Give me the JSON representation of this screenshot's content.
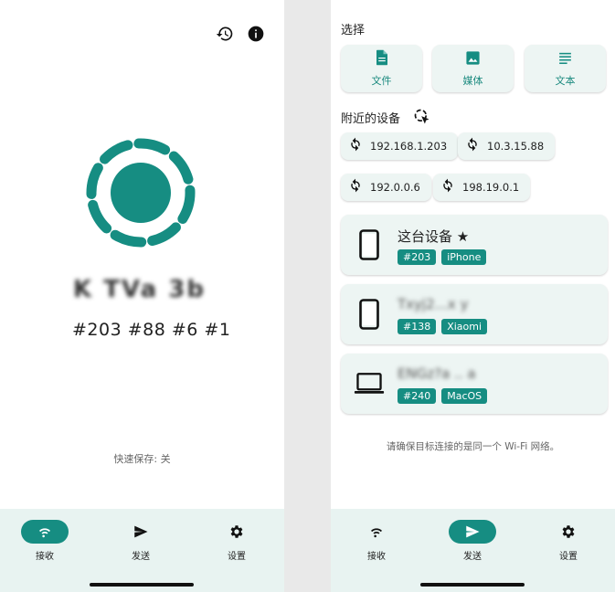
{
  "colors": {
    "accent": "#168d82",
    "chip_bg": "#edf5f3",
    "nav_bg": "#e8f3f1"
  },
  "receive": {
    "device_name": "K TVa 3b",
    "alias": "#203 #88 #6 #1",
    "quick_save": "快速保存: 关",
    "icons": [
      "history-icon",
      "info-icon"
    ]
  },
  "send": {
    "select_title": "选择",
    "pick_buttons": [
      {
        "label": "文件",
        "icon": "file-icon"
      },
      {
        "label": "媒体",
        "icon": "image-icon"
      },
      {
        "label": "文本",
        "icon": "text-icon"
      }
    ],
    "nearby_title": "附近的设备",
    "ips": [
      "192.168.1.203",
      "10.3.15.88",
      "192.0.0.6",
      "198.19.0.1"
    ],
    "devices": [
      {
        "name": "这台设备 ★",
        "tags": [
          "#203",
          "iPhone"
        ],
        "icon": "phone-icon"
      },
      {
        "name": "Txyj2...x y",
        "tags": [
          "#138",
          "Xiaomi"
        ],
        "icon": "phone-icon"
      },
      {
        "name": "ENGz?a .. a",
        "tags": [
          "#240",
          "MacOS"
        ],
        "icon": "laptop-icon"
      }
    ],
    "hint": "请确保目标连接的是同一个 Wi-Fi 网络。"
  },
  "nav": {
    "items": [
      {
        "label": "接收",
        "icon": "wifi-icon"
      },
      {
        "label": "发送",
        "icon": "send-icon"
      },
      {
        "label": "设置",
        "icon": "gear-icon"
      }
    ],
    "left_active": 0,
    "right_active": 1
  }
}
